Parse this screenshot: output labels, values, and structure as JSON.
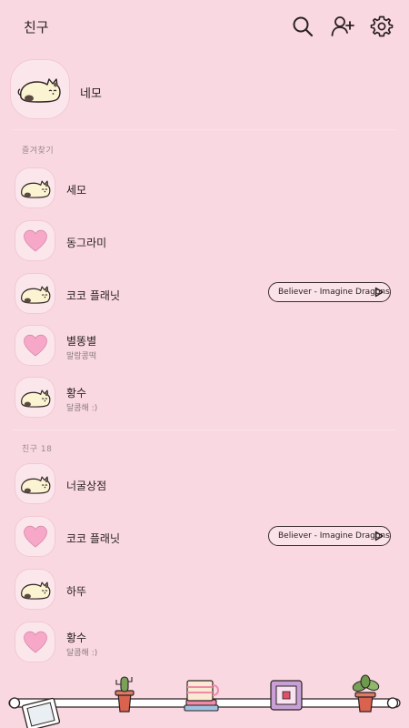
{
  "header": {
    "title": "친구",
    "icons": [
      "search-icon",
      "add-user-icon",
      "gear-icon"
    ]
  },
  "my_profile": {
    "name": "네모",
    "avatar": "cat-icon"
  },
  "favorites": {
    "label": "즐겨찾기",
    "items": [
      {
        "name": "세모",
        "avatar": "cat-icon",
        "status": "",
        "music": ""
      },
      {
        "name": "동그라미",
        "avatar": "heart-icon",
        "status": "",
        "music": ""
      },
      {
        "name": "코코 플래닛",
        "avatar": "cat-icon",
        "status": "",
        "music": "Believer - Imagine Dragons"
      },
      {
        "name": "별똥별",
        "avatar": "heart-icon",
        "status": "말랑콩떡",
        "music": ""
      },
      {
        "name": "황수",
        "avatar": "cat-icon",
        "status": "달콤해 :)",
        "music": ""
      }
    ]
  },
  "friends": {
    "label": "친구 18",
    "items": [
      {
        "name": "너굴상점",
        "avatar": "cat-icon",
        "status": "",
        "music": ""
      },
      {
        "name": "코코 플래닛",
        "avatar": "heart-icon",
        "status": "",
        "music": "Believer - Imagine Dragons"
      },
      {
        "name": "하뚜",
        "avatar": "cat-icon",
        "status": "",
        "music": ""
      },
      {
        "name": "황수",
        "avatar": "heart-icon",
        "status": "달콤해 :)",
        "music": ""
      }
    ]
  },
  "colors": {
    "background": "#f9d8e1",
    "avatar_bg": "#fbe6ec",
    "heart": "#f7a8c8",
    "cat_body": "#fbf3d2",
    "ink": "#3a2e2e"
  },
  "bottom_shelf": [
    "frame-icon",
    "cactus-icon",
    "coffee-cup-icon",
    "box-icon",
    "plant-icon"
  ]
}
